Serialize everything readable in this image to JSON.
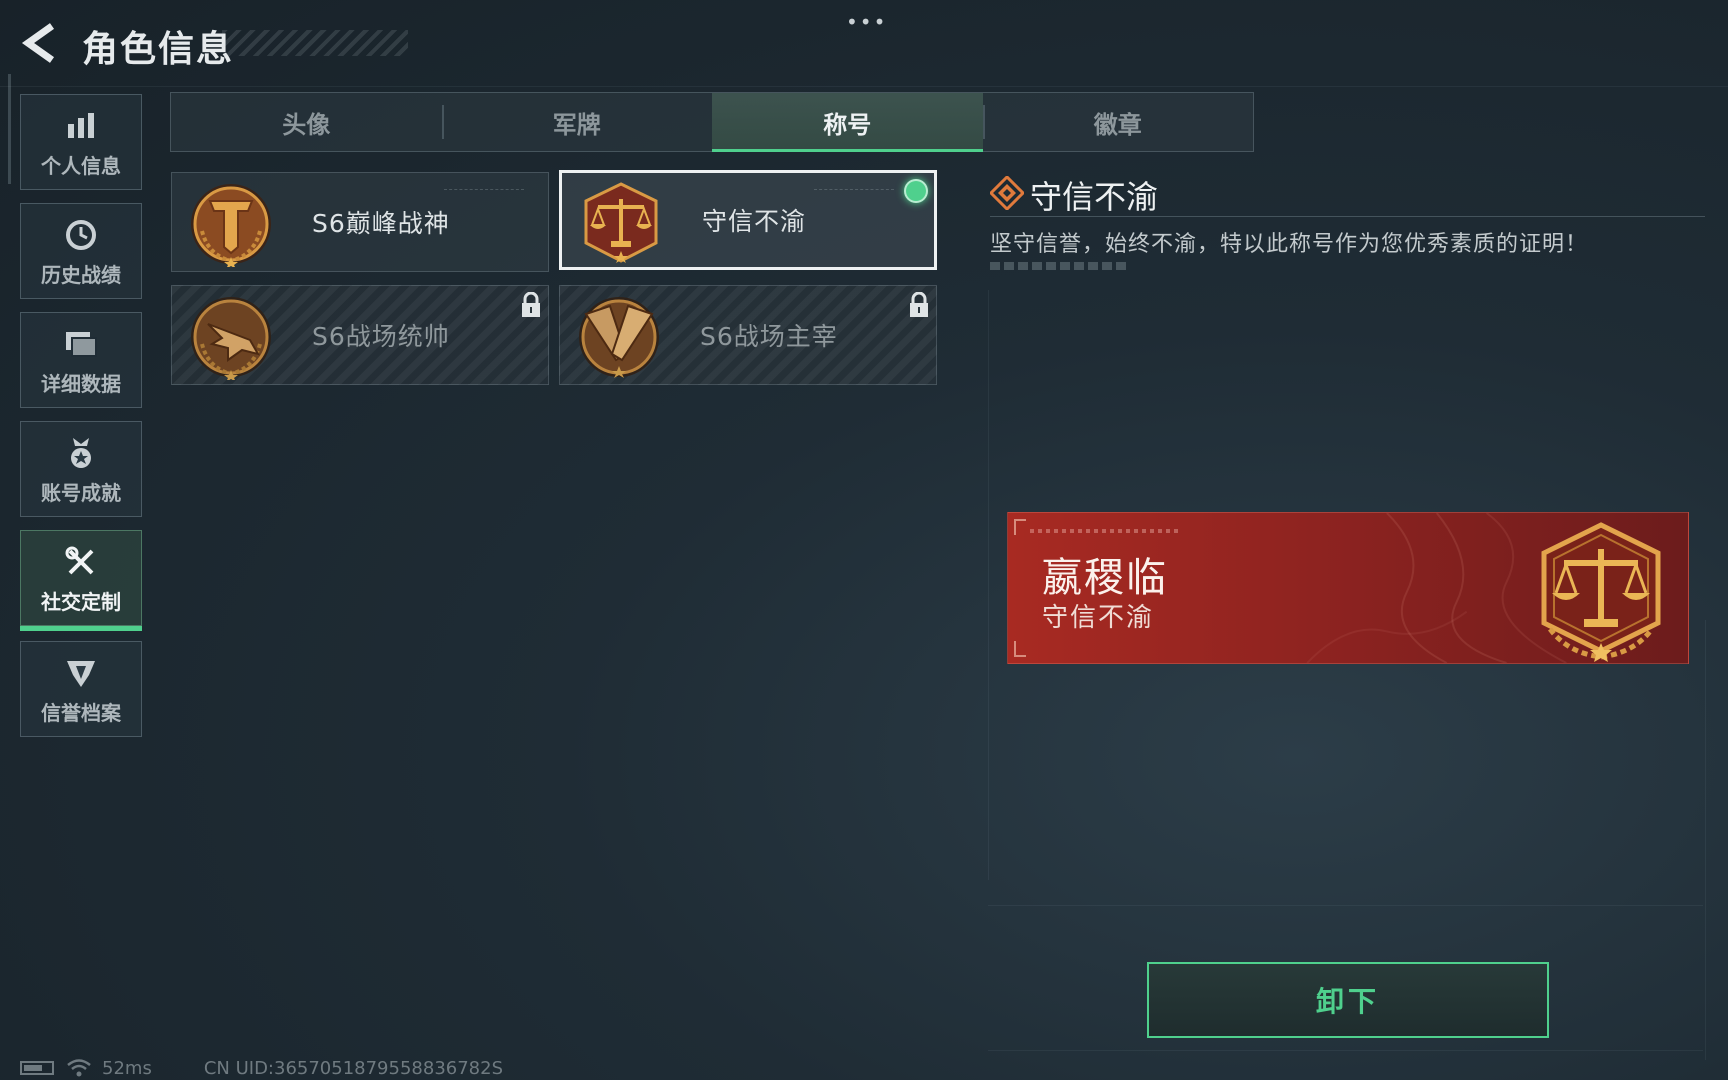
{
  "header": {
    "title": "角色信息",
    "back_icon": "back-arrow-icon",
    "more_icon": "more-dots-icon",
    "more_text": "•••"
  },
  "sidebar": {
    "items": [
      {
        "label": "个人信息",
        "icon": "bar-chart-icon",
        "active": false
      },
      {
        "label": "历史战绩",
        "icon": "history-clock-icon",
        "active": false
      },
      {
        "label": "详细数据",
        "icon": "folder-icon",
        "active": false
      },
      {
        "label": "账号成就",
        "icon": "medal-icon",
        "active": false
      },
      {
        "label": "社交定制",
        "icon": "tools-icon",
        "active": true
      },
      {
        "label": "信誉档案",
        "icon": "reputation-icon",
        "active": false
      }
    ]
  },
  "tabs": [
    {
      "label": "头像",
      "active": false
    },
    {
      "label": "军牌",
      "active": false
    },
    {
      "label": "称号",
      "active": true
    },
    {
      "label": "徽章",
      "active": false
    }
  ],
  "titles": [
    {
      "name": "S6巅峰战神",
      "emblem": "t-shield-emblem-icon",
      "locked": false,
      "selected": false,
      "equipped": false
    },
    {
      "name": "守信不渝",
      "emblem": "justice-scales-emblem-icon",
      "locked": false,
      "selected": true,
      "equipped": true
    },
    {
      "name": "S6战场统帅",
      "emblem": "fighter-jet-emblem-icon",
      "locked": true,
      "selected": false,
      "equipped": false
    },
    {
      "name": "S6战场主宰",
      "emblem": "crossed-blades-emblem-icon",
      "locked": true,
      "selected": false,
      "equipped": false
    }
  ],
  "detail": {
    "title": "守信不渝",
    "description": "坚守信誉，始终不渝，特以此称号作为您优秀素质的证明！",
    "icon": "diamond-title-icon"
  },
  "banner": {
    "player_name": "嬴稷临",
    "title": "守信不渝",
    "emblem": "justice-scales-emblem-icon"
  },
  "actions": {
    "unequip_label": "卸下"
  },
  "status_bar": {
    "ping": "52ms",
    "uid": "CN UID:3657051879558836782S"
  },
  "colors": {
    "accent_green": "#4fd08d",
    "banner_red": "#a82a22",
    "emblem_gold": "#d99a44"
  }
}
